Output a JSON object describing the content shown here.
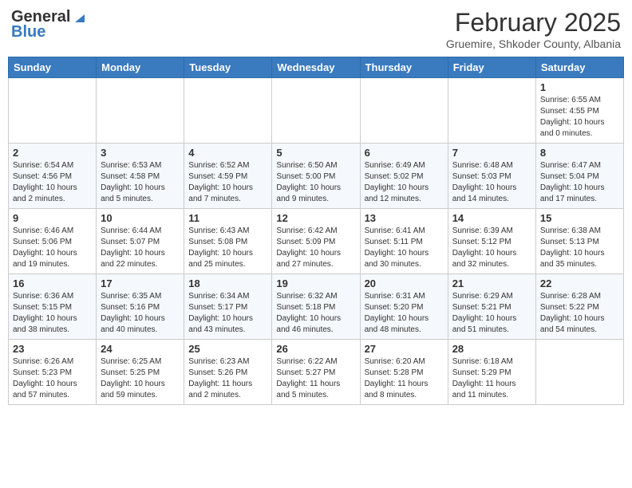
{
  "header": {
    "logo_general": "General",
    "logo_blue": "Blue",
    "month_year": "February 2025",
    "location": "Gruemire, Shkoder County, Albania"
  },
  "columns": [
    "Sunday",
    "Monday",
    "Tuesday",
    "Wednesday",
    "Thursday",
    "Friday",
    "Saturday"
  ],
  "weeks": [
    [
      {
        "day": "",
        "info": ""
      },
      {
        "day": "",
        "info": ""
      },
      {
        "day": "",
        "info": ""
      },
      {
        "day": "",
        "info": ""
      },
      {
        "day": "",
        "info": ""
      },
      {
        "day": "",
        "info": ""
      },
      {
        "day": "1",
        "info": "Sunrise: 6:55 AM\nSunset: 4:55 PM\nDaylight: 10 hours\nand 0 minutes."
      }
    ],
    [
      {
        "day": "2",
        "info": "Sunrise: 6:54 AM\nSunset: 4:56 PM\nDaylight: 10 hours\nand 2 minutes."
      },
      {
        "day": "3",
        "info": "Sunrise: 6:53 AM\nSunset: 4:58 PM\nDaylight: 10 hours\nand 5 minutes."
      },
      {
        "day": "4",
        "info": "Sunrise: 6:52 AM\nSunset: 4:59 PM\nDaylight: 10 hours\nand 7 minutes."
      },
      {
        "day": "5",
        "info": "Sunrise: 6:50 AM\nSunset: 5:00 PM\nDaylight: 10 hours\nand 9 minutes."
      },
      {
        "day": "6",
        "info": "Sunrise: 6:49 AM\nSunset: 5:02 PM\nDaylight: 10 hours\nand 12 minutes."
      },
      {
        "day": "7",
        "info": "Sunrise: 6:48 AM\nSunset: 5:03 PM\nDaylight: 10 hours\nand 14 minutes."
      },
      {
        "day": "8",
        "info": "Sunrise: 6:47 AM\nSunset: 5:04 PM\nDaylight: 10 hours\nand 17 minutes."
      }
    ],
    [
      {
        "day": "9",
        "info": "Sunrise: 6:46 AM\nSunset: 5:06 PM\nDaylight: 10 hours\nand 19 minutes."
      },
      {
        "day": "10",
        "info": "Sunrise: 6:44 AM\nSunset: 5:07 PM\nDaylight: 10 hours\nand 22 minutes."
      },
      {
        "day": "11",
        "info": "Sunrise: 6:43 AM\nSunset: 5:08 PM\nDaylight: 10 hours\nand 25 minutes."
      },
      {
        "day": "12",
        "info": "Sunrise: 6:42 AM\nSunset: 5:09 PM\nDaylight: 10 hours\nand 27 minutes."
      },
      {
        "day": "13",
        "info": "Sunrise: 6:41 AM\nSunset: 5:11 PM\nDaylight: 10 hours\nand 30 minutes."
      },
      {
        "day": "14",
        "info": "Sunrise: 6:39 AM\nSunset: 5:12 PM\nDaylight: 10 hours\nand 32 minutes."
      },
      {
        "day": "15",
        "info": "Sunrise: 6:38 AM\nSunset: 5:13 PM\nDaylight: 10 hours\nand 35 minutes."
      }
    ],
    [
      {
        "day": "16",
        "info": "Sunrise: 6:36 AM\nSunset: 5:15 PM\nDaylight: 10 hours\nand 38 minutes."
      },
      {
        "day": "17",
        "info": "Sunrise: 6:35 AM\nSunset: 5:16 PM\nDaylight: 10 hours\nand 40 minutes."
      },
      {
        "day": "18",
        "info": "Sunrise: 6:34 AM\nSunset: 5:17 PM\nDaylight: 10 hours\nand 43 minutes."
      },
      {
        "day": "19",
        "info": "Sunrise: 6:32 AM\nSunset: 5:18 PM\nDaylight: 10 hours\nand 46 minutes."
      },
      {
        "day": "20",
        "info": "Sunrise: 6:31 AM\nSunset: 5:20 PM\nDaylight: 10 hours\nand 48 minutes."
      },
      {
        "day": "21",
        "info": "Sunrise: 6:29 AM\nSunset: 5:21 PM\nDaylight: 10 hours\nand 51 minutes."
      },
      {
        "day": "22",
        "info": "Sunrise: 6:28 AM\nSunset: 5:22 PM\nDaylight: 10 hours\nand 54 minutes."
      }
    ],
    [
      {
        "day": "23",
        "info": "Sunrise: 6:26 AM\nSunset: 5:23 PM\nDaylight: 10 hours\nand 57 minutes."
      },
      {
        "day": "24",
        "info": "Sunrise: 6:25 AM\nSunset: 5:25 PM\nDaylight: 10 hours\nand 59 minutes."
      },
      {
        "day": "25",
        "info": "Sunrise: 6:23 AM\nSunset: 5:26 PM\nDaylight: 11 hours\nand 2 minutes."
      },
      {
        "day": "26",
        "info": "Sunrise: 6:22 AM\nSunset: 5:27 PM\nDaylight: 11 hours\nand 5 minutes."
      },
      {
        "day": "27",
        "info": "Sunrise: 6:20 AM\nSunset: 5:28 PM\nDaylight: 11 hours\nand 8 minutes."
      },
      {
        "day": "28",
        "info": "Sunrise: 6:18 AM\nSunset: 5:29 PM\nDaylight: 11 hours\nand 11 minutes."
      },
      {
        "day": "",
        "info": ""
      }
    ]
  ]
}
